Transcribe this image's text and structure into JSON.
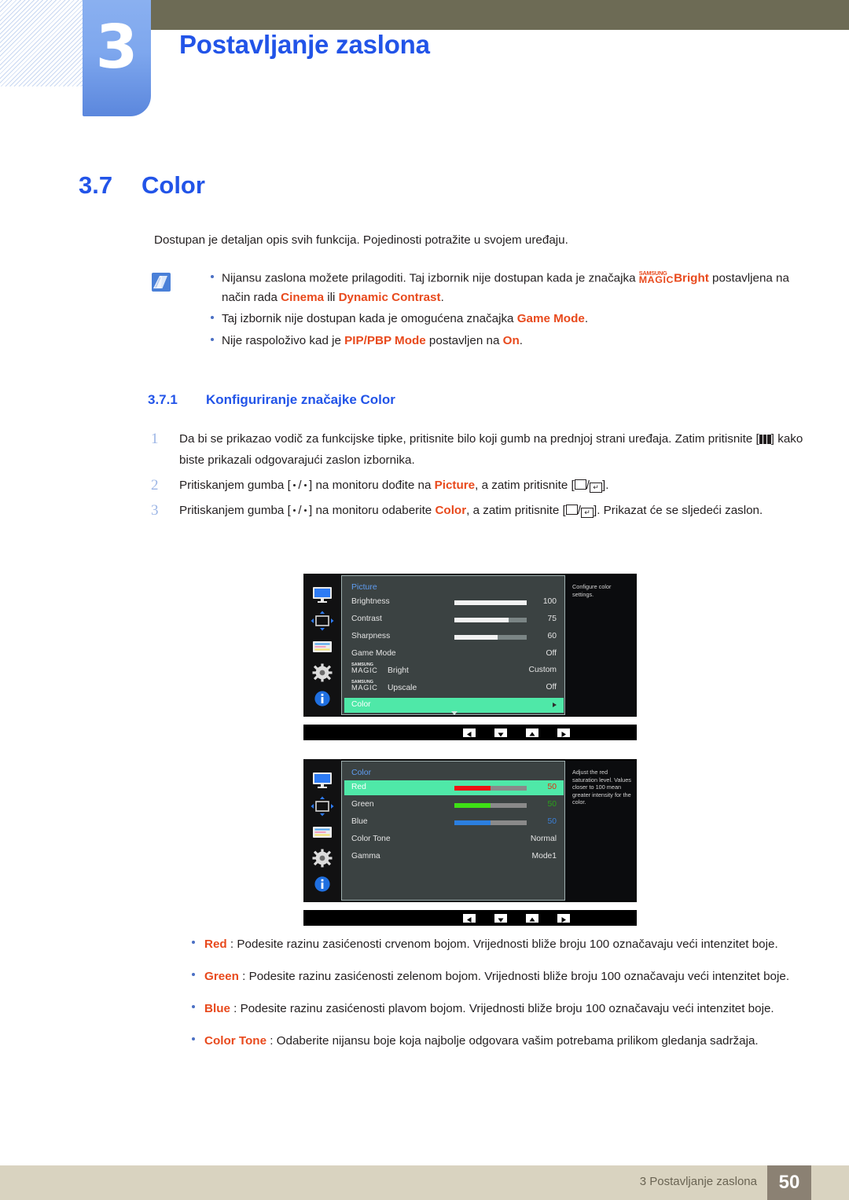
{
  "header": {
    "chapter_number": "3",
    "chapter_title": "Postavljanje zaslona"
  },
  "section": {
    "number": "3.7",
    "title": "Color",
    "intro": "Dostupan je detaljan opis svih funkcija. Pojedinosti potražite u svojem uređaju."
  },
  "notes": {
    "icon": "note-pencil-icon",
    "items": [
      {
        "pre": "Nijansu zaslona možete prilagoditi. Taj izbornik nije dostupan kada je značajka ",
        "magic_top": "SAMSUNG",
        "magic_bottom": "MAGIC",
        "magic_word": "Bright",
        "mid": " postavljena na način rada ",
        "em1": "Cinema",
        "between": " ili ",
        "em2": "Dynamic Contrast",
        "post": "."
      },
      {
        "pre": "Taj izbornik nije dostupan kada je omogućena značajka ",
        "em1": "Game Mode",
        "post": "."
      },
      {
        "pre": "Nije raspoloživo kad je ",
        "em1": "PIP/PBP Mode",
        "mid": " postavljen na ",
        "em2": "On",
        "post": "."
      }
    ]
  },
  "subsection": {
    "number": "3.7.1",
    "title": "Konfiguriranje značajke Color"
  },
  "steps": [
    {
      "num": "1",
      "part1": "Da bi se prikazao vodič za funkcijske tipke, pritisnite bilo koji gumb na prednjoj strani uređaja. Zatim pritisnite [",
      "part2": "] kako biste prikazali odgovarajući zaslon izbornika."
    },
    {
      "num": "2",
      "part1": "Pritiskanjem gumba [",
      "part2": "] na monitoru dođite na ",
      "em1": "Picture",
      "part3": ", a zatim pritisnite [",
      "part4": "]."
    },
    {
      "num": "3",
      "part1": "Pritiskanjem gumba [",
      "part2": "] na monitoru odaberite ",
      "em1": "Color",
      "part3": ", a zatim pritisnite [",
      "part4": "]. Prikazat će se sljedeći zaslon."
    }
  ],
  "osd1": {
    "title": "Picture",
    "description": "Configure color settings.",
    "highlight_color": "#4fe8a8",
    "rows": [
      {
        "label": "Brightness",
        "value": "100",
        "bar": 100,
        "bar_color": "#f2f2f2",
        "selected": false
      },
      {
        "label": "Contrast",
        "value": "75",
        "bar": 75,
        "bar_color": "#f2f2f2",
        "selected": false
      },
      {
        "label": "Sharpness",
        "value": "60",
        "bar": 60,
        "bar_color": "#f2f2f2",
        "selected": false
      },
      {
        "label": "Game Mode",
        "value": "Off",
        "bar": null,
        "selected": false
      },
      {
        "label": "MAGICBright",
        "magic": true,
        "magic_top": "SAMSUNG",
        "magic_mid": "MAGIC",
        "magic_word": "Bright",
        "value": "Custom",
        "bar": null,
        "selected": false
      },
      {
        "label": "MAGICUpscale",
        "magic": true,
        "magic_top": "SAMSUNG",
        "magic_mid": "MAGIC",
        "magic_word": "Upscale",
        "value": "Off",
        "bar": null,
        "selected": false
      },
      {
        "label": "Color",
        "value": "",
        "bar": null,
        "selected": true,
        "arrow": true
      }
    ],
    "nav_icons": [
      "left-arrow-key",
      "down-arrow-key",
      "up-arrow-key",
      "right-arrow-key"
    ]
  },
  "osd2": {
    "title": "Color",
    "description": "Adjust the red saturation level. Values closer to 100 mean greater intensity for the color.",
    "highlight_color": "#4fe8a8",
    "rows": [
      {
        "label": "Red",
        "value": "50",
        "bar": 50,
        "bar_color": "#ee1111",
        "value_color": "#e02b0b",
        "selected": true
      },
      {
        "label": "Green",
        "value": "50",
        "bar": 50,
        "bar_color": "#3ee015",
        "value_color": "#2aa21a",
        "selected": false
      },
      {
        "label": "Blue",
        "value": "50",
        "bar": 50,
        "bar_color": "#2b7fe0",
        "value_color": "#3a7fd8",
        "selected": false
      },
      {
        "label": "Color Tone",
        "value": "Normal",
        "bar": null,
        "selected": false
      },
      {
        "label": "Gamma",
        "value": "Mode1",
        "bar": null,
        "selected": false
      }
    ],
    "nav_icons": [
      "left-arrow-key",
      "down-arrow-key",
      "up-arrow-key",
      "right-arrow-key"
    ]
  },
  "bullets": [
    {
      "term": "Red",
      "rest": " : Podesite razinu zasićenosti crvenom bojom. Vrijednosti bliže broju 100 označavaju veći intenzitet boje."
    },
    {
      "term": "Green",
      "rest": " : Podesite razinu zasićenosti zelenom bojom. Vrijednosti bliže broju 100 označavaju veći intenzitet boje."
    },
    {
      "term": "Blue",
      "rest": " : Podesite razinu zasićenosti plavom bojom. Vrijednosti bliže broju 100 označavaju veći intenzitet boje."
    },
    {
      "term": "Color Tone",
      "rest": " : Odaberite nijansu boje koja najbolje odgovara vašim potrebama prilikom gledanja sadržaja."
    }
  ],
  "footer": {
    "text": "3 Postavljanje zaslona",
    "page": "50"
  }
}
